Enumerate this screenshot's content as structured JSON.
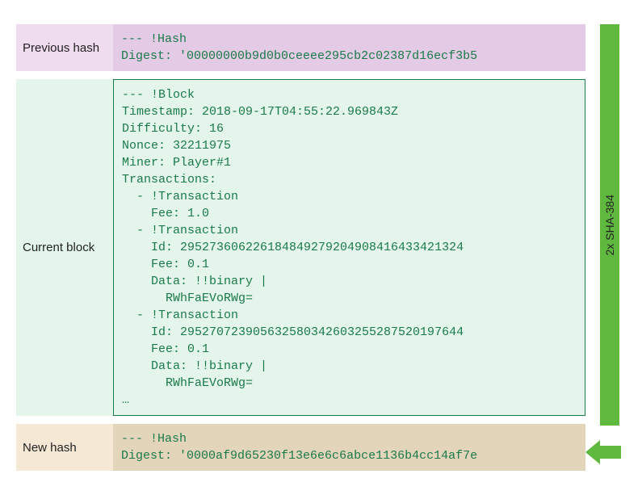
{
  "labels": {
    "previous_hash": "Previous hash",
    "current_block": "Current block",
    "new_hash": "New hash"
  },
  "previous_hash": {
    "header": "--- !Hash",
    "digest_label": "Digest:",
    "digest_value": "'00000000b9d0b0ceeee295cb2c02387d16ecf3b5"
  },
  "current_block": {
    "lines": [
      "--- !Block",
      "Timestamp: 2018-09-17T04:55:22.969843Z",
      "Difficulty: 16",
      "Nonce: 32211975",
      "Miner: Player#1",
      "Transactions:",
      "  - !Transaction",
      "    Fee: 1.0",
      "  - !Transaction",
      "    Id: 295273606226184849279204908416433421324",
      "    Fee: 0.1",
      "    Data: !!binary |",
      "      RWhFaEVoRWg=",
      "  - !Transaction",
      "    Id: 295270723905632580342603255287520197644",
      "    Fee: 0.1",
      "    Data: !!binary |",
      "      RWhFaEVoRWg=",
      "…"
    ]
  },
  "new_hash": {
    "header": "--- !Hash",
    "digest_label": "Digest:",
    "digest_value": "'0000af9d65230f13e6e6c6abce1136b4cc14af7e"
  },
  "sidebar": {
    "label": "2x SHA-384"
  },
  "colors": {
    "accent_green": "#5fb93f",
    "code_green": "#1a7a4a"
  }
}
